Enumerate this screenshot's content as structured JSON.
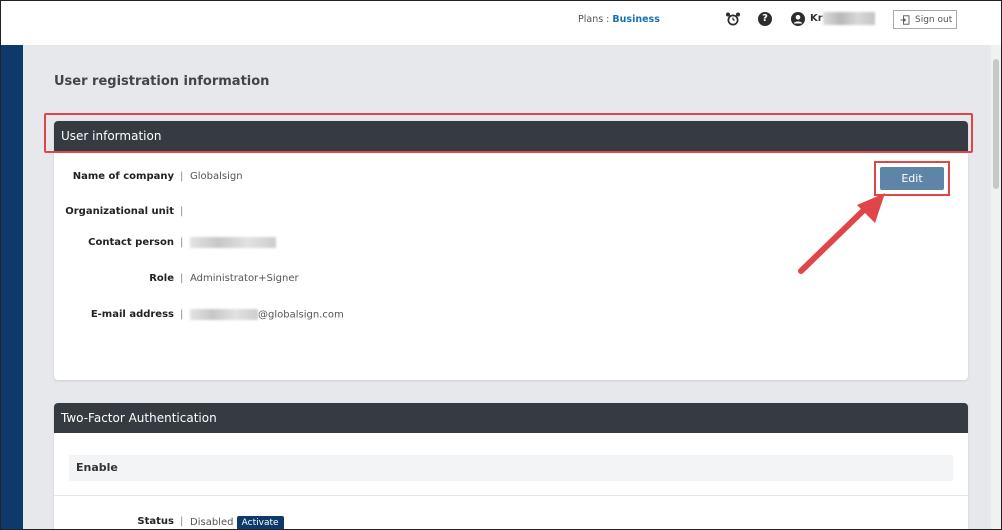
{
  "topbar": {
    "plans_label": "Plans :",
    "plan_value": "Business",
    "user_name": "Kr",
    "signout_label": "Sign out",
    "help_glyph": "?"
  },
  "page": {
    "title": "User registration information"
  },
  "user_info": {
    "header": "User information",
    "edit_label": "Edit",
    "fields": [
      {
        "label": "Name of company",
        "value": "Globalsign"
      },
      {
        "label": "Organizational unit",
        "value": ""
      },
      {
        "label": "Contact person",
        "value": ""
      },
      {
        "label": "Role",
        "value": "Administrator+Signer"
      },
      {
        "label": "E-mail address",
        "value": "@globalsign.com"
      }
    ]
  },
  "two_factor": {
    "header": "Two-Factor Authentication",
    "enable_label": "Enable",
    "status_label": "Status",
    "status_value": "Disabled",
    "activate_label": "Activate"
  },
  "colors": {
    "accent_red": "#e0454a",
    "header_dark": "#353b41",
    "edit_button": "#5e84a8",
    "sidebar_navy": "#0d3a6b",
    "plan_blue": "#1a6fb5"
  },
  "icons": [
    "alarm-clock-icon",
    "help-icon",
    "user-icon",
    "sign-out-icon",
    "annotation-arrow"
  ]
}
